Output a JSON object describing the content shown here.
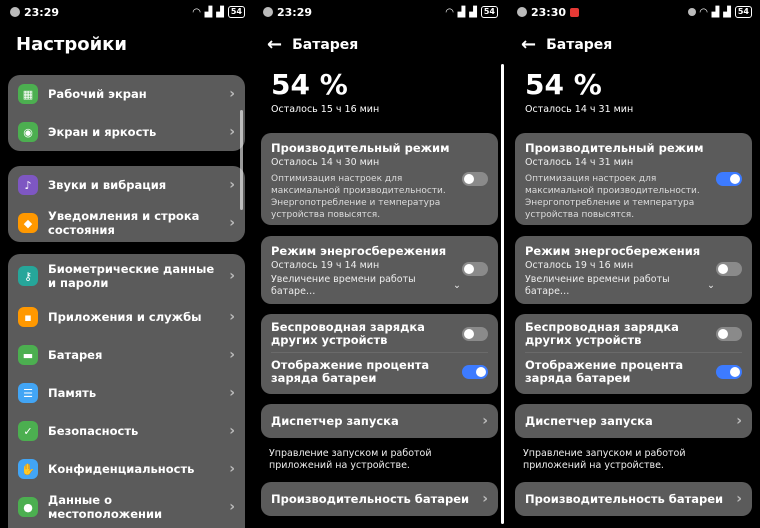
{
  "status": {
    "time1": "23:29",
    "time2": "23:29",
    "time3": "23:30",
    "battery": "54"
  },
  "settings": {
    "title": "Настройки",
    "groups": [
      [
        {
          "label": "Рабочий экран",
          "icon": "home-screen-icon",
          "color": "#4caf50"
        },
        {
          "label": "Экран и яркость",
          "icon": "display-icon",
          "color": "#4caf50"
        }
      ],
      [
        {
          "label": "Звуки и вибрация",
          "icon": "sound-icon",
          "color": "#7e57c2"
        },
        {
          "label": "Уведомления и строка состояния",
          "icon": "notification-icon",
          "color": "#ff9800"
        }
      ],
      [
        {
          "label": "Биометрические данные и пароли",
          "icon": "key-icon",
          "color": "#26a69a"
        },
        {
          "label": "Приложения и службы",
          "icon": "apps-icon",
          "color": "#ff9800"
        },
        {
          "label": "Батарея",
          "icon": "battery-icon",
          "color": "#4caf50"
        },
        {
          "label": "Память",
          "icon": "storage-icon",
          "color": "#42a5f5"
        },
        {
          "label": "Безопасность",
          "icon": "shield-icon",
          "color": "#4caf50"
        },
        {
          "label": "Конфиденциальность",
          "icon": "privacy-icon",
          "color": "#42a5f5"
        },
        {
          "label": "Данные о местоположении",
          "icon": "location-icon",
          "color": "#4caf50"
        }
      ]
    ]
  },
  "battery_a": {
    "title": "Батарея",
    "percent": "54 %",
    "remaining": "Осталось 15 ч 16 мин",
    "perf_title": "Производительный режим",
    "perf_sub": "Осталось 14 ч 30 мин",
    "perf_desc": "Оптимизация настроек для максимальной производительности. Энергопотребление и температура устройства повысятся.",
    "perf_on": false,
    "save_title": "Режим энергосбережения",
    "save_sub": "Осталось 19 ч 14 мин",
    "save_desc": "Увеличение времени работы батаре…",
    "save_on": false,
    "wireless_label": "Беспроводная зарядка других устройств",
    "wireless_on": false,
    "pct_label": "Отображение процента заряда батареи",
    "pct_on": true,
    "launch_label": "Диспетчер запуска",
    "launch_note": "Управление запуском и работой приложений на устройстве.",
    "perf_battery_label": "Производительность батареи"
  },
  "battery_b": {
    "title": "Батарея",
    "percent": "54 %",
    "remaining": "Осталось 14 ч 31 мин",
    "perf_title": "Производительный режим",
    "perf_sub": "Осталось 14 ч 31 мин",
    "perf_desc": "Оптимизация настроек для максимальной производительности. Энергопотребление и температура устройства повысятся.",
    "perf_on": true,
    "save_title": "Режим энергосбережения",
    "save_sub": "Осталось 19 ч 16 мин",
    "save_desc": "Увеличение времени работы батаре…",
    "save_on": false,
    "wireless_label": "Беспроводная зарядка других устройств",
    "wireless_on": false,
    "pct_label": "Отображение процента заряда батареи",
    "pct_on": true,
    "launch_label": "Диспетчер запуска",
    "launch_note": "Управление запуском и работой приложений на устройстве.",
    "perf_battery_label": "Производительность батареи"
  }
}
